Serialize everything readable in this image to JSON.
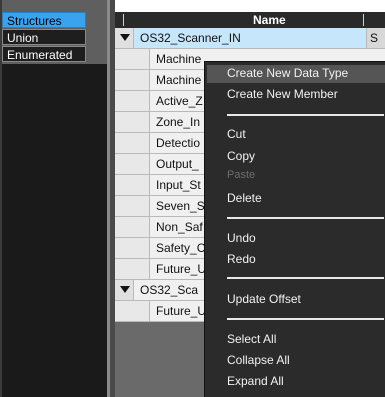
{
  "type_list": {
    "items": [
      {
        "label": "Structures",
        "selected": true
      },
      {
        "label": "Union",
        "selected": false
      },
      {
        "label": "Enumerated",
        "selected": false
      }
    ]
  },
  "table": {
    "header": {
      "name_label": "Name"
    },
    "rows": [
      {
        "name": "OS32_Scanner_IN",
        "level": 0,
        "expanded": true,
        "selected": true,
        "right": "S"
      },
      {
        "name": "Machine",
        "level": 1
      },
      {
        "name": "Machine",
        "level": 1
      },
      {
        "name": "Active_Z",
        "level": 1
      },
      {
        "name": "Zone_In",
        "level": 1
      },
      {
        "name": "Detectio",
        "level": 1
      },
      {
        "name": "Output_",
        "level": 1
      },
      {
        "name": "Input_St",
        "level": 1
      },
      {
        "name": "Seven_S",
        "level": 1
      },
      {
        "name": "Non_Saf",
        "level": 1
      },
      {
        "name": "Safety_C",
        "level": 1
      },
      {
        "name": "Future_U",
        "level": 1
      },
      {
        "name": "OS32_Sca",
        "level": 0,
        "expanded": true
      },
      {
        "name": "Future_U",
        "level": 1
      }
    ]
  },
  "context_menu": {
    "items": [
      {
        "label": "Create New Data Type",
        "enabled": true,
        "highlighted": true
      },
      {
        "label": "Create New Member",
        "enabled": true
      },
      {
        "label": "Cut",
        "enabled": true
      },
      {
        "label": "Copy",
        "enabled": true
      },
      {
        "label": "Paste",
        "enabled": false
      },
      {
        "label": "Delete",
        "enabled": true
      },
      {
        "label": "Undo",
        "enabled": true
      },
      {
        "label": "Redo",
        "enabled": true
      },
      {
        "label": "Update Offset",
        "enabled": true
      },
      {
        "label": "Select All",
        "enabled": true
      },
      {
        "label": "Collapse All",
        "enabled": true
      },
      {
        "label": "Expand All",
        "enabled": true
      }
    ]
  }
}
